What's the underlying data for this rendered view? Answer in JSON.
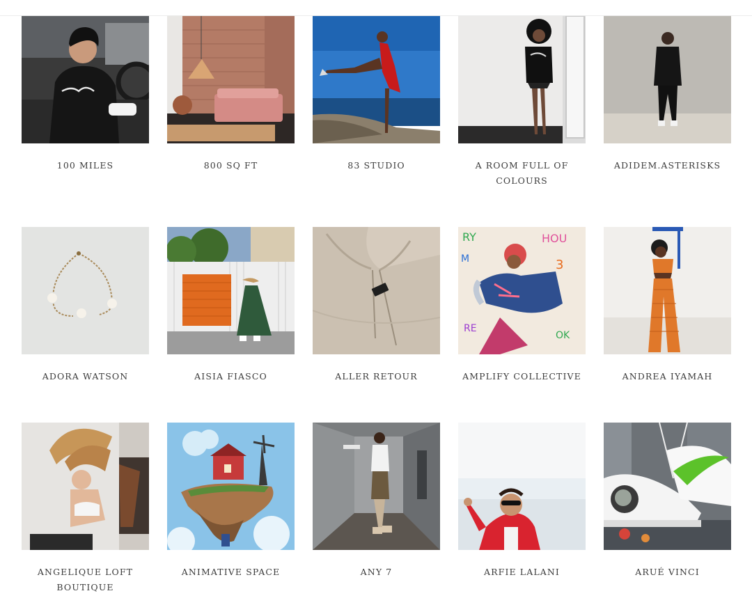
{
  "vendors": [
    {
      "name": "100 MILES"
    },
    {
      "name": "800 SQ FT"
    },
    {
      "name": "83 STUDIO"
    },
    {
      "name": "A ROOM FULL OF COLOURS"
    },
    {
      "name": "ADIDEM.ASTERISKS"
    },
    {
      "name": "ADORA WATSON"
    },
    {
      "name": "AISIA FIASCO"
    },
    {
      "name": "ALLER RETOUR"
    },
    {
      "name": "AMPLIFY COLLECTIVE"
    },
    {
      "name": "ANDREA IYAMAH"
    },
    {
      "name": "ANGELIQUE LOFT BOUTIQUE"
    },
    {
      "name": "ANIMATIVE SPACE"
    },
    {
      "name": "ANY 7"
    },
    {
      "name": "ARFIE LALANI"
    },
    {
      "name": "ARUÉ VINCI"
    }
  ]
}
